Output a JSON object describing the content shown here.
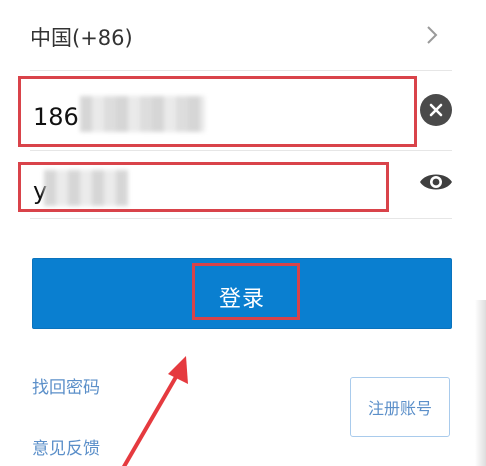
{
  "country": {
    "label": "中国(+86)"
  },
  "phone": {
    "value": "186"
  },
  "password": {
    "value": "y"
  },
  "login": {
    "label": "登录"
  },
  "links": {
    "forgot_password": "找回密码",
    "feedback": "意见反馈"
  },
  "register": {
    "label": "注册账号"
  },
  "colors": {
    "primary": "#0a7fd0",
    "link": "#5b8fc9",
    "highlight": "#d9434a"
  },
  "icons": {
    "country_chevron": "chevron-right-icon",
    "clear": "clear-icon",
    "visibility": "eye-icon",
    "annotation": "red-arrow"
  }
}
